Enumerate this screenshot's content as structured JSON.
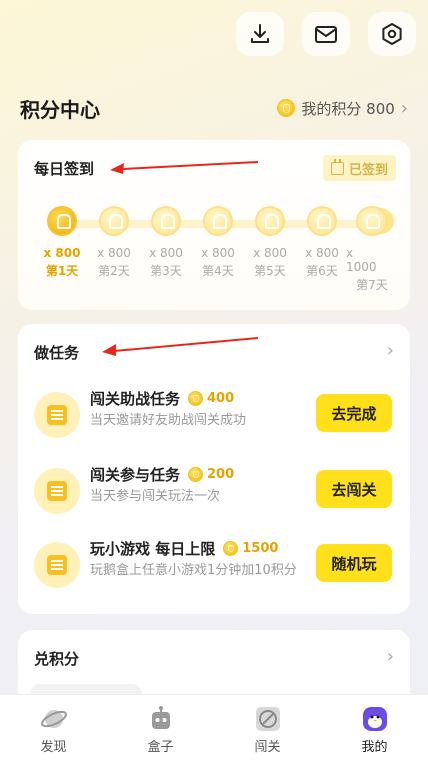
{
  "header": {
    "title": "积分中心",
    "my_points_label": "我的积分 800"
  },
  "topbar": {
    "icons": [
      "download-icon",
      "mail-icon",
      "settings-icon"
    ]
  },
  "checkin": {
    "title": "每日签到",
    "status_badge": "已签到",
    "days": [
      {
        "amount": "x 800",
        "label": "第1天",
        "active": true
      },
      {
        "amount": "x 800",
        "label": "第2天",
        "active": false
      },
      {
        "amount": "x 800",
        "label": "第3天",
        "active": false
      },
      {
        "amount": "x 800",
        "label": "第4天",
        "active": false
      },
      {
        "amount": "x 800",
        "label": "第5天",
        "active": false
      },
      {
        "amount": "x 800",
        "label": "第6天",
        "active": false
      },
      {
        "amount": "x 1000",
        "label": "第7天",
        "active": false
      }
    ]
  },
  "tasks": {
    "title": "做任务",
    "items": [
      {
        "name": "闯关助战任务",
        "reward": "400",
        "desc": "当天邀请好友助战闯关成功",
        "button": "去完成"
      },
      {
        "name": "闯关参与任务",
        "reward": "200",
        "desc": "当天参与闯关玩法一次",
        "button": "去闯关"
      },
      {
        "name": "玩小游戏 每日上限",
        "reward": "1500",
        "desc": "玩鹅盒上任意小游戏1分钟加10积分",
        "button": "随机玩"
      }
    ]
  },
  "redeem": {
    "title": "兑积分"
  },
  "nav": [
    {
      "label": "发现",
      "icon": "planet-icon"
    },
    {
      "label": "盒子",
      "icon": "robot-icon"
    },
    {
      "label": "闯关",
      "icon": "disc-icon"
    },
    {
      "label": "我的",
      "icon": "penguin-icon"
    }
  ],
  "colors": {
    "accent": "#ffe01b",
    "coin": "#f5b800",
    "arrow": "#e8261c"
  }
}
